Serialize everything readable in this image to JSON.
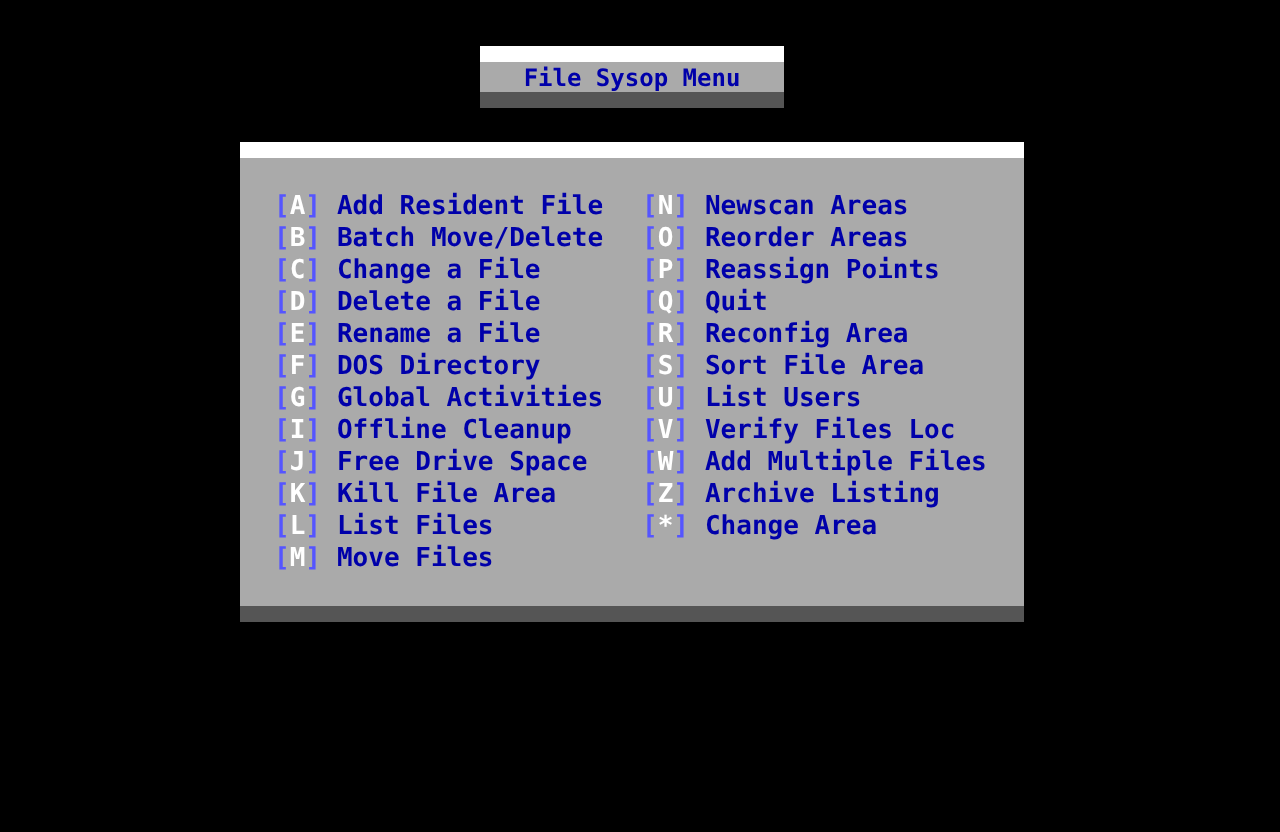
{
  "title": "File Sysop Menu",
  "columns": [
    {
      "items": [
        {
          "key": "[A]",
          "label": "Add Resident File"
        },
        {
          "key": "[B]",
          "label": "Batch Move/Delete"
        },
        {
          "key": "[C]",
          "label": "Change a File"
        },
        {
          "key": "[D]",
          "label": "Delete a File"
        },
        {
          "key": "[E]",
          "label": "Rename a File"
        },
        {
          "key": "[F]",
          "label": "DOS Directory"
        },
        {
          "key": "[G]",
          "label": "Global Activities"
        },
        {
          "key": "[I]",
          "label": "Offline Cleanup"
        },
        {
          "key": "[J]",
          "label": "Free Drive Space"
        },
        {
          "key": "[K]",
          "label": "Kill File Area"
        },
        {
          "key": "[L]",
          "label": "List Files"
        },
        {
          "key": "[M]",
          "label": "Move Files"
        }
      ]
    },
    {
      "items": [
        {
          "key": "[N]",
          "label": "Newscan Areas"
        },
        {
          "key": "[O]",
          "label": "Reorder Areas"
        },
        {
          "key": "[P]",
          "label": "Reassign Points"
        },
        {
          "key": "[Q]",
          "label": "Quit"
        },
        {
          "key": "[R]",
          "label": "Reconfig Area"
        },
        {
          "key": "[S]",
          "label": "Sort File Area"
        },
        {
          "key": "[U]",
          "label": "List Users"
        },
        {
          "key": "[V]",
          "label": "Verify Files Loc"
        },
        {
          "key": "[W]",
          "label": "Add Multiple Files"
        },
        {
          "key": "[Z]",
          "label": "Archive Listing"
        },
        {
          "key": "[*]",
          "label": "Change Area"
        }
      ]
    }
  ]
}
